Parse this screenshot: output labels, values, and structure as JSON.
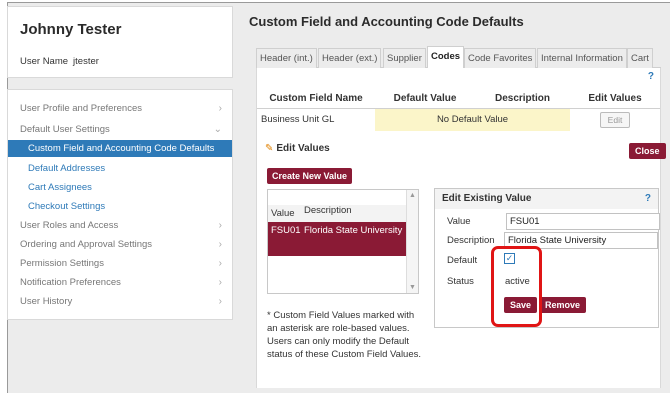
{
  "sidebar": {
    "user_name_heading": "Johnny Tester",
    "username_label": "User Name",
    "username_value": "jtester",
    "items": [
      {
        "label": "User Profile and Preferences",
        "chevron": "›"
      },
      {
        "label": "Default User Settings",
        "chevron": "⌄"
      },
      {
        "label": "Custom Field and Accounting Code Defaults"
      },
      {
        "label": "Default Addresses"
      },
      {
        "label": "Cart Assignees"
      },
      {
        "label": "Checkout Settings"
      },
      {
        "label": "User Roles and Access",
        "chevron": "›"
      },
      {
        "label": "Ordering and Approval Settings",
        "chevron": "›"
      },
      {
        "label": "Permission Settings",
        "chevron": "›"
      },
      {
        "label": "Notification Preferences",
        "chevron": "›"
      },
      {
        "label": "User History",
        "chevron": "›"
      }
    ]
  },
  "main": {
    "title": "Custom Field and Accounting Code Defaults",
    "tabs": [
      "Header (int.)",
      "Header (ext.)",
      "Supplier",
      "Codes",
      "Code Favorites",
      "Internal Information",
      "Cart"
    ],
    "active_tab": "Codes",
    "help_label": "?",
    "table": {
      "headers": [
        "Custom Field Name",
        "Default Value",
        "Description",
        "Edit Values"
      ],
      "row": {
        "name": "Business Unit GL",
        "default_value": "No Default Value",
        "description": "",
        "edit_label": "Edit"
      }
    },
    "edit_values_label": "Edit Values",
    "close_label": "Close",
    "create_new_label": "Create New Value",
    "value_list": {
      "headers": [
        "Value",
        "Description"
      ],
      "rows": [
        {
          "value": "FSU01",
          "description": "Florida State University"
        }
      ]
    },
    "note": "* Custom Field Values marked with an asterisk are role-based values. Users can only modify the Default status of these Custom Field Values.",
    "edit_existing": {
      "heading": "Edit Existing Value",
      "help": "?",
      "value_label": "Value",
      "value": "FSU01",
      "description_label": "Description",
      "description": "Florida State University",
      "default_label": "Default",
      "default_checked": true,
      "status_label": "Status",
      "status": "active",
      "save_label": "Save",
      "remove_label": "Remove"
    }
  },
  "colors": {
    "accent_blue": "#2e7ab8",
    "button_maroon": "#8a1a35",
    "highlight_red": "#e01515",
    "default_value_bg": "#fbf5c9"
  }
}
